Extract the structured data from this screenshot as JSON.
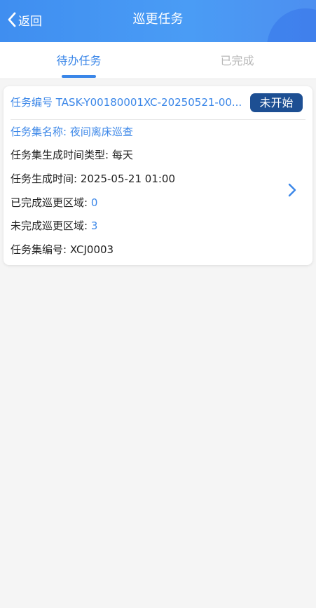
{
  "header": {
    "back_label": "返回",
    "title": "巡更任务",
    "gradient_start": "#3f8ef0",
    "gradient_end": "#4d8ff0"
  },
  "tabs": [
    {
      "label": "待办任务",
      "active": true
    },
    {
      "label": "已完成",
      "active": false
    }
  ],
  "task": {
    "number_label": "任务编号",
    "number_value": "TASK-Y00180001XC-20250521-00...",
    "status": "未开始",
    "set_name_label": "任务集名称",
    "set_name_value": "夜间离床巡查",
    "gen_type_label": "任务集生成时间类型",
    "gen_type_value": "每天",
    "gen_time_label": "任务生成时间",
    "gen_time_value": "2025-05-21 01:00",
    "done_label": "已完成巡更区域",
    "done_value": "0",
    "undone_label": "未完成巡更区域",
    "undone_value": "3",
    "set_no_label": "任务集编号",
    "set_no_value": "XCJ0003"
  },
  "colors": {
    "accent": "#3a86e8",
    "badge": "#1d4f93",
    "inactive_tab": "#b8b8b8"
  },
  "icons": {
    "back": "chevron-left-icon",
    "detail": "chevron-right-icon"
  }
}
